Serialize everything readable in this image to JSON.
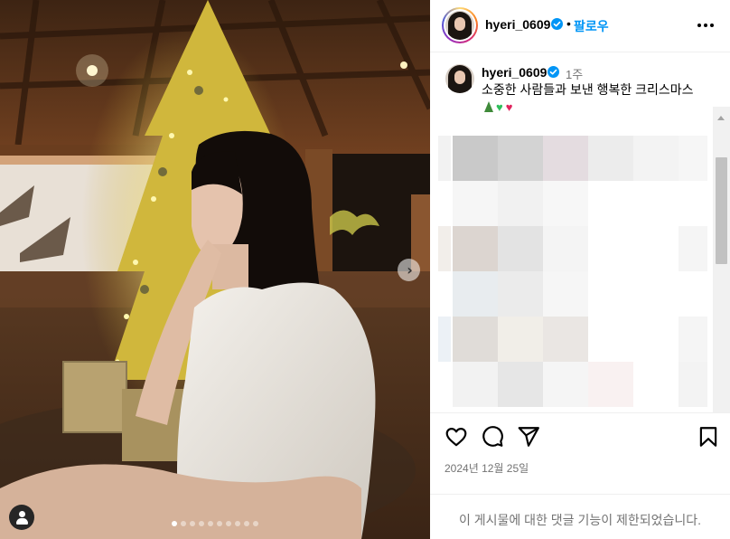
{
  "post": {
    "username": "hyeri_0609",
    "follow_label": "팔로우",
    "separator": "•",
    "caption_username": "hyeri_0609",
    "caption_time": "1주",
    "caption_text": "소중한 사람들과 보낸 행복한 크리스마스",
    "caption_emojis": [
      "christmas-tree",
      "green-heart",
      "red-heart"
    ],
    "date": "2024년 12월 25일",
    "comments_disabled": "이 게시물에 대한 댓글 기능이 제한되었습니다."
  },
  "carousel": {
    "total": 10,
    "active": 0
  },
  "icons": {
    "verified": "verified-badge-icon",
    "more": "more-options-icon",
    "like": "heart-icon",
    "comment": "comment-icon",
    "share": "send-icon",
    "save": "bookmark-icon",
    "next": "chevron-right-icon",
    "tag": "user-tag-icon"
  },
  "colors": {
    "link_blue": "#0095f6",
    "muted_text": "#737373",
    "verified_blue": "#0095f6"
  }
}
